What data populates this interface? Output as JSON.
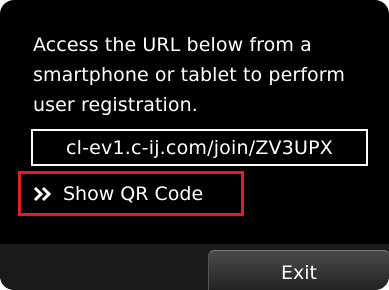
{
  "dialog": {
    "message": "Access the URL below from a smartphone or tablet to perform user registration.",
    "url": "cl-ev1.c-ij.com/join/ZV3UPX",
    "show_qr_label": "Show QR Code",
    "exit_label": "Exit"
  },
  "colors": {
    "background": "#000000",
    "text": "#ffffff",
    "highlight_border": "#e31d25"
  },
  "icons": {
    "qr_link_icon": "double-chevron-right-icon"
  }
}
